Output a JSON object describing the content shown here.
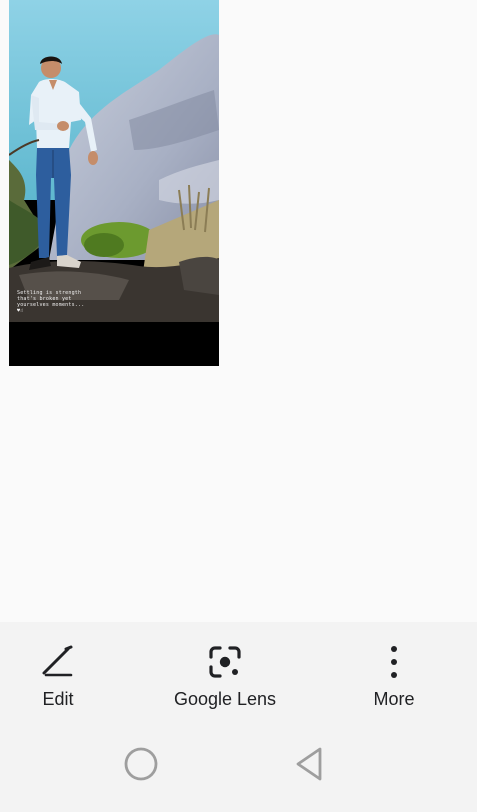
{
  "photo": {
    "caption": "Settling is strength\nthat's broken yet\nyourselves moments...\n♥☝"
  },
  "actions": {
    "edit": {
      "label": "Edit",
      "icon": "edit-pencil-icon"
    },
    "lens": {
      "label": "Google Lens",
      "icon": "google-lens-icon"
    },
    "more": {
      "label": "More",
      "icon": "more-vertical-icon"
    }
  },
  "nav": {
    "home": {
      "icon": "home-circle-icon"
    },
    "back": {
      "icon": "back-triangle-icon"
    }
  },
  "colors": {
    "background": "#fafafa",
    "bar_background": "#f3f3f3",
    "icon": "#202124",
    "nav_icon": "#9e9e9e"
  }
}
